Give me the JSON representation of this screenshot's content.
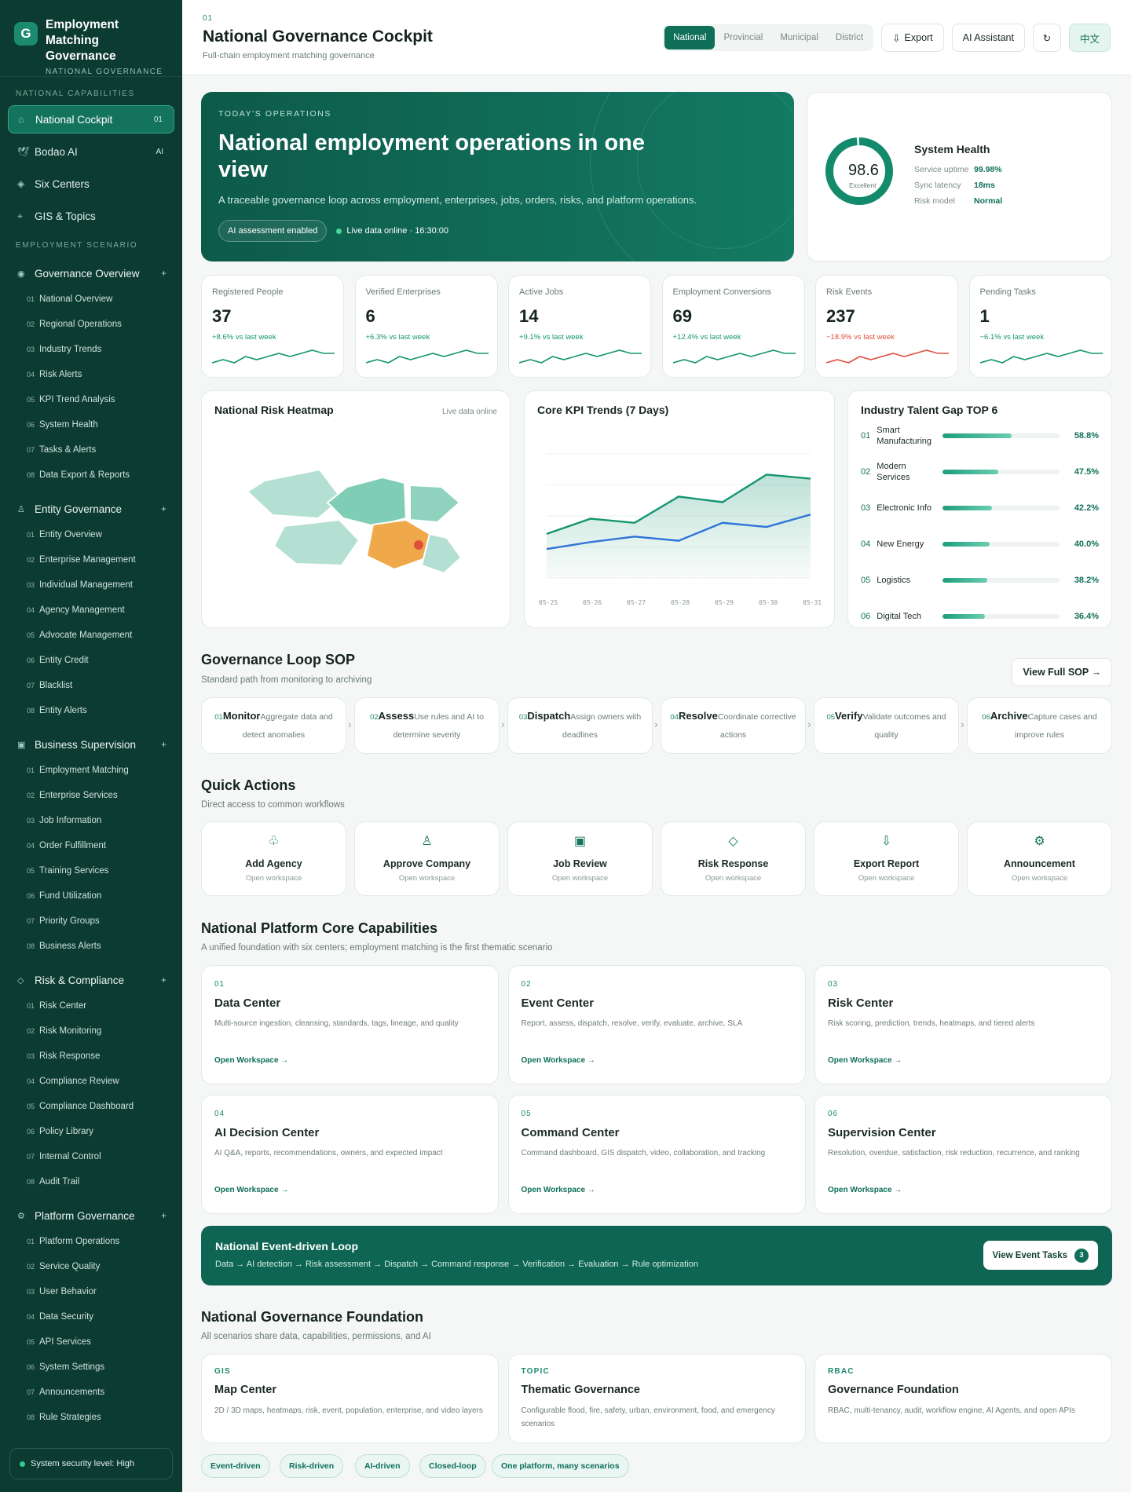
{
  "brand": {
    "logo": "G",
    "title": "Employment Matching Governance",
    "subtitle": "NATIONAL GOVERNANCE"
  },
  "sidebar": {
    "cap_label": "NATIONAL CAPABILITIES",
    "items": [
      {
        "label": "National Cockpit",
        "badge": "01",
        "icon": "home-icon",
        "glyph": "⌂"
      },
      {
        "label": "Bodao AI",
        "badge": "AI",
        "icon": "bird-icon",
        "glyph": "🕊"
      },
      {
        "label": "Six Centers",
        "badge": "",
        "icon": "diamond-icon",
        "glyph": "◈"
      },
      {
        "label": "GIS & Topics",
        "badge": "",
        "icon": "target-icon",
        "glyph": "⌖"
      }
    ],
    "scen_label": "EMPLOYMENT SCENARIO",
    "groups": [
      {
        "label": "Governance Overview",
        "glyph": "◉",
        "subs": [
          "National Overview",
          "Regional Operations",
          "Industry Trends",
          "Risk Alerts",
          "KPI Trend Analysis",
          "System Health",
          "Tasks & Alerts",
          "Data Export & Reports"
        ]
      },
      {
        "label": "Entity Governance",
        "glyph": "♙",
        "subs": [
          "Entity Overview",
          "Enterprise Management",
          "Individual Management",
          "Agency Management",
          "Advocate Management",
          "Entity Credit",
          "Blacklist",
          "Entity Alerts"
        ]
      },
      {
        "label": "Business Supervision",
        "glyph": "▣",
        "subs": [
          "Employment Matching",
          "Enterprise Services",
          "Job Information",
          "Order Fulfillment",
          "Training Services",
          "Fund Utilization",
          "Priority Groups",
          "Business Alerts"
        ]
      },
      {
        "label": "Risk & Compliance",
        "glyph": "◇",
        "subs": [
          "Risk Center",
          "Risk Monitoring",
          "Risk Response",
          "Compliance Review",
          "Compliance Dashboard",
          "Policy Library",
          "Internal Control",
          "Audit Trail"
        ]
      },
      {
        "label": "Platform Governance",
        "glyph": "⚙",
        "subs": [
          "Platform Operations",
          "Service Quality",
          "User Behavior",
          "Data Security",
          "API Services",
          "System Settings",
          "Announcements",
          "Rule Strategies"
        ]
      }
    ],
    "plus": "+",
    "security": "System security level: High"
  },
  "topbar": {
    "num": "01",
    "title": "National Governance Cockpit",
    "subtitle": "Full-chain employment matching governance",
    "scopes": [
      "National",
      "Provincial",
      "Municipal",
      "District"
    ],
    "export": "Export",
    "ai": "AI Assistant",
    "refresh": "↻",
    "lang": "中文"
  },
  "hero": {
    "kicker": "TODAY'S OPERATIONS",
    "title": "National employment operations in one view",
    "desc": "A traceable governance loop across employment, enterprises, jobs, orders, risks, and platform operations.",
    "pill": "AI assessment enabled",
    "live": "Live data online · 16:30:00"
  },
  "health": {
    "score": "98.6",
    "score_value": 98.6,
    "grade": "Excellent",
    "title": "System Health",
    "rows": [
      {
        "k": "Service uptime",
        "v": "99.98%"
      },
      {
        "k": "Sync latency",
        "v": "18ms"
      },
      {
        "k": "Risk model",
        "v": "Normal"
      }
    ]
  },
  "kpis": [
    {
      "label": "Registered People",
      "value": "37",
      "delta": "+8.6% vs last week",
      "dir": "up",
      "spark": [
        3,
        4,
        3,
        5,
        4,
        5,
        6,
        5,
        6,
        7,
        6,
        6
      ]
    },
    {
      "label": "Verified Enterprises",
      "value": "6",
      "delta": "+6.3% vs last week",
      "dir": "up",
      "spark": [
        3,
        4,
        3,
        5,
        4,
        5,
        6,
        5,
        6,
        7,
        6,
        6
      ]
    },
    {
      "label": "Active Jobs",
      "value": "14",
      "delta": "+9.1% vs last week",
      "dir": "up",
      "spark": [
        3,
        4,
        3,
        5,
        4,
        5,
        6,
        5,
        6,
        7,
        6,
        6
      ]
    },
    {
      "label": "Employment Conversions",
      "value": "69",
      "delta": "+12.4% vs last week",
      "dir": "up",
      "spark": [
        3,
        4,
        3,
        5,
        4,
        5,
        6,
        5,
        6,
        7,
        6,
        6
      ]
    },
    {
      "label": "Risk Events",
      "value": "237",
      "delta": "−18.9% vs last week",
      "dir": "down",
      "spark": [
        3,
        4,
        3,
        5,
        4,
        5,
        6,
        5,
        6,
        7,
        6,
        6
      ]
    },
    {
      "label": "Pending Tasks",
      "value": "1",
      "delta": "−6.1% vs last week",
      "dir": "up",
      "spark": [
        3,
        4,
        3,
        5,
        4,
        5,
        6,
        5,
        6,
        7,
        6,
        6
      ]
    }
  ],
  "colors": {
    "up": "#14956f",
    "down": "#e0503c",
    "accent": "#0f6f58",
    "line1": "#14956f",
    "line2": "#2f74d8"
  },
  "heatmap": {
    "title": "National Risk Heatmap",
    "status": "Live data online"
  },
  "kpi_trend": {
    "title": "Core KPI Trends (7 Days)"
  },
  "chart_data": {
    "type": "line",
    "x": [
      "05-25",
      "05-26",
      "05-27",
      "05-28",
      "05-29",
      "05-30",
      "05-31"
    ],
    "series": [
      {
        "values": [
          52,
          63,
          60,
          79,
          75,
          95,
          92
        ]
      },
      {
        "values": [
          41,
          46,
          50,
          47,
          60,
          57,
          66
        ]
      }
    ],
    "ylim": [
      20,
      110
    ],
    "grid": true
  },
  "gap": {
    "title": "Industry Talent Gap TOP 6",
    "rows": [
      {
        "n": "01",
        "label": "Smart Manufacturing",
        "pct": "58.8%",
        "v": 58.8
      },
      {
        "n": "02",
        "label": "Modern Services",
        "pct": "47.5%",
        "v": 47.5
      },
      {
        "n": "03",
        "label": "Electronic Info",
        "pct": "42.2%",
        "v": 42.2
      },
      {
        "n": "04",
        "label": "New Energy",
        "pct": "40.0%",
        "v": 40.0
      },
      {
        "n": "05",
        "label": "Logistics",
        "pct": "38.2%",
        "v": 38.2
      },
      {
        "n": "06",
        "label": "Digital Tech",
        "pct": "36.4%",
        "v": 36.4
      }
    ]
  },
  "sop": {
    "title": "Governance Loop SOP",
    "subtitle": "Standard path from monitoring to archiving",
    "button": "View Full SOP →",
    "arrow": "›",
    "steps": [
      {
        "n": "01",
        "t": "Monitor",
        "d": "Aggregate data and detect anomalies"
      },
      {
        "n": "02",
        "t": "Assess",
        "d": "Use rules and AI to determine severity"
      },
      {
        "n": "03",
        "t": "Dispatch",
        "d": "Assign owners with deadlines"
      },
      {
        "n": "04",
        "t": "Resolve",
        "d": "Coordinate corrective actions"
      },
      {
        "n": "05",
        "t": "Verify",
        "d": "Validate outcomes and quality"
      },
      {
        "n": "06",
        "t": "Archive",
        "d": "Capture cases and improve rules"
      }
    ]
  },
  "quick": {
    "title": "Quick Actions",
    "subtitle": "Direct access to common workflows",
    "open": "Open workspace",
    "items": [
      {
        "t": "Add Agency",
        "icon": "club-icon",
        "g": "♧"
      },
      {
        "t": "Approve Company",
        "icon": "person-icon",
        "g": "♙"
      },
      {
        "t": "Job Review",
        "icon": "square-icon",
        "g": "▣"
      },
      {
        "t": "Risk Response",
        "icon": "diamond-icon",
        "g": "◇"
      },
      {
        "t": "Export Report",
        "icon": "download-icon",
        "g": "⇩"
      },
      {
        "t": "Announcement",
        "icon": "gear-icon",
        "g": "⚙"
      }
    ]
  },
  "core": {
    "title": "National Platform Core Capabilities",
    "subtitle": "A unified foundation with six centers; employment matching is the first thematic scenario",
    "link": "Open Workspace →",
    "items": [
      {
        "n": "01",
        "t": "Data Center",
        "d": "Multi-source ingestion, cleansing, standards, tags, lineage, and quality"
      },
      {
        "n": "02",
        "t": "Event Center",
        "d": "Report, assess, dispatch, resolve, verify, evaluate, archive, SLA"
      },
      {
        "n": "03",
        "t": "Risk Center",
        "d": "Risk scoring, prediction, trends, heatmaps, and tiered alerts"
      },
      {
        "n": "04",
        "t": "AI Decision Center",
        "d": "AI Q&A, reports, recommendations, owners, and expected impact"
      },
      {
        "n": "05",
        "t": "Command Center",
        "d": "Command dashboard, GIS dispatch, video, collaboration, and tracking"
      },
      {
        "n": "06",
        "t": "Supervision Center",
        "d": "Resolution, overdue, satisfaction, risk reduction, recurrence, and ranking"
      }
    ]
  },
  "loop": {
    "title": "National Event-driven Loop",
    "steps": "Data → AI detection → Risk assessment → Dispatch → Command response → Verification → Evaluation → Rule optimization",
    "button": "View Event Tasks",
    "count": "3"
  },
  "foundation": {
    "title": "National Governance Foundation",
    "subtitle": "All scenarios share data, capabilities, permissions, and AI",
    "items": [
      {
        "tag": "GIS",
        "t": "Map Center",
        "d": "2D / 3D maps, heatmaps, risk, event, population, enterprise, and video layers"
      },
      {
        "tag": "TOPIC",
        "t": "Thematic Governance",
        "d": "Configurable flood, fire, safety, urban, environment, food, and emergency scenarios"
      },
      {
        "tag": "RBAC",
        "t": "Governance Foundation",
        "d": "RBAC, multi-tenancy, audit, workflow engine, AI Agents, and open APIs"
      }
    ],
    "tags": [
      "Event-driven",
      "Risk-driven",
      "AI-driven",
      "Closed-loop",
      "One platform, many scenarios"
    ]
  }
}
